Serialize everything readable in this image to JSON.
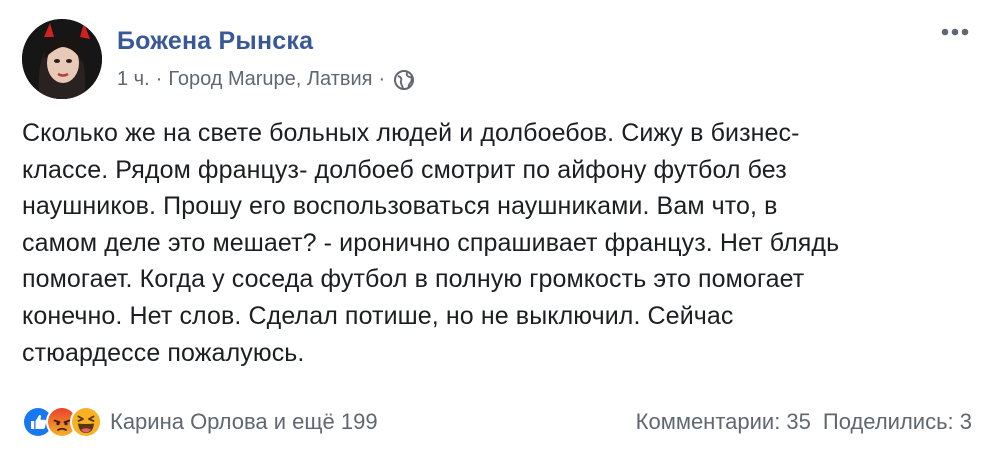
{
  "post": {
    "author": "Божена Рынска",
    "time": "1 ч.",
    "separator": "·",
    "location": "Город Marupe, Латвия",
    "icons": {
      "avatar": "profile-photo",
      "more": "more-horizontal-icon",
      "privacy": "globe-icon",
      "reactions": [
        "like-icon",
        "angry-icon",
        "haha-icon"
      ]
    },
    "text_lines": [
      "Сколько же на свете больных людей и долбоебов. Сижу в бизнес-",
      "классе. Рядом француз- долбоеб смотрит по айфону футбол без",
      "наушников. Прошу его воспользоваться наушниками. Вам что, в",
      "самом деле это мешает? - иронично спрашивает француз. Нет блядь",
      "помогает. Когда у соседа футбол в полную громкость это помогает",
      "конечно. Нет слов. Сделал потише, но не выключил. Сейчас",
      "стюардессе пожалуюсь."
    ]
  },
  "footer": {
    "reactions_text": "Карина Орлова и ещё 199",
    "comments": "Комментарии: 35",
    "shares": "Поделились: 3"
  },
  "colors": {
    "author": "#385898",
    "meta": "#606770",
    "text": "#1c1e21",
    "like": "#1877f2",
    "angry": "#e9710f",
    "haha": "#f7b125"
  }
}
